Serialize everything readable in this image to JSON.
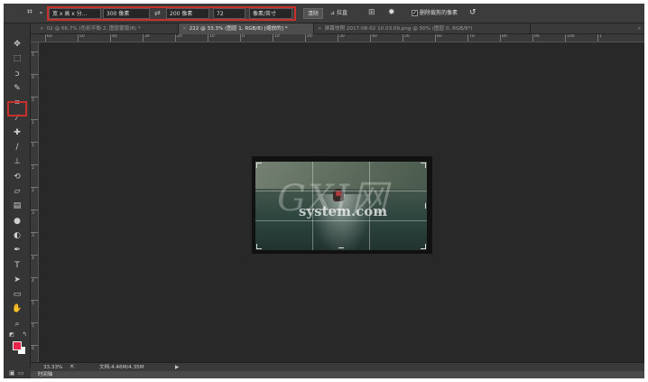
{
  "options_bar": {
    "ratio_select": "宽 x 高 x 分...",
    "width_value": "300 像素",
    "height_value": "200 像素",
    "resolution_value": "72",
    "unit_select": "像素/英寸",
    "clear_label": "清除",
    "straighten_label": "拉直",
    "delete_pixels_label": "删除裁剪的像素",
    "delete_pixels_checked": true
  },
  "tabs": [
    {
      "label": "02 @ 66.7% (色彩平衡 2, 图层蒙版/8) *",
      "active": false
    },
    {
      "label": "222 @ 33.3% (图层 1, RGB/8) [缩放的] *",
      "active": true
    },
    {
      "label": "屏幕快照 2017-08-02 10.03.09.png @ 50% (图层 0, RGB/8*)",
      "active": false
    }
  ],
  "ruler_top_labels": [
    "60",
    "50",
    "40",
    "30",
    "20",
    "10",
    "0",
    "10",
    "20",
    "30",
    "40",
    "50",
    "60",
    "70",
    "80",
    "90",
    "100",
    "1"
  ],
  "ruler_left_labels": [
    "5",
    "0",
    "5",
    "1",
    "1",
    "2",
    "2",
    "3",
    "3",
    "4",
    "4",
    "5",
    "5",
    "6"
  ],
  "status_bar": {
    "zoom": "33.33%",
    "doc_size": "文档:4.46M/4.35M"
  },
  "timeline_label": "时间轴",
  "watermark": {
    "logo": "GXI网",
    "text": "system.com"
  },
  "colors": {
    "foreground": "#e8244a",
    "background": "#ffffff",
    "highlight": "#c9302c"
  },
  "tools": [
    "move-tool-icon",
    "marquee-tool-icon",
    "lasso-tool-icon",
    "quick-select-tool-icon",
    "crop-tool-icon",
    "eyedropper-tool-icon",
    "healing-brush-tool-icon",
    "brush-tool-icon",
    "clone-stamp-tool-icon",
    "history-brush-tool-icon",
    "eraser-tool-icon",
    "gradient-tool-icon",
    "blur-tool-icon",
    "dodge-tool-icon",
    "pen-tool-icon",
    "type-tool-icon",
    "path-select-tool-icon",
    "shape-tool-icon",
    "hand-tool-icon",
    "zoom-tool-icon"
  ]
}
